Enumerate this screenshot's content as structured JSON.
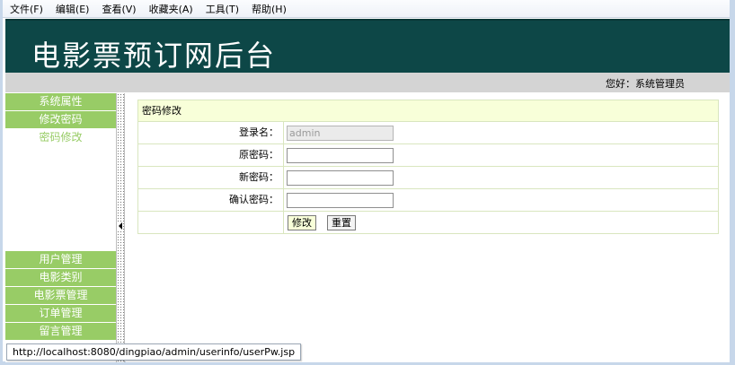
{
  "menubar": {
    "items": [
      "文件(F)",
      "编辑(E)",
      "查看(V)",
      "收藏夹(A)",
      "工具(T)",
      "帮助(H)"
    ]
  },
  "banner": {
    "title": "电影票预订网后台"
  },
  "userbar": {
    "greeting": "您好：系统管理员"
  },
  "sidebar": {
    "top_items": [
      "系统属性",
      "修改密码"
    ],
    "sub_items": [
      "密码修改"
    ],
    "bottom_items": [
      "用户管理",
      "电影类别",
      "电影票管理",
      "订单管理",
      "留言管理"
    ]
  },
  "form": {
    "title": "密码修改",
    "login_label": "登录名：",
    "login_value": "admin",
    "old_pwd_label": "原密码：",
    "new_pwd_label": "新密码：",
    "confirm_pwd_label": "确认密码：",
    "submit_label": "修改",
    "reset_label": "重置"
  },
  "status": {
    "url": "http://localhost:8080/dingpiao/admin/userinfo/userPw.jsp"
  },
  "colors": {
    "banner_bg": "#0d4747",
    "menu_green": "#98cc66",
    "form_title_bg": "#f8ffd9"
  },
  "icons": [
    "collapse-left-arrow-icon"
  ]
}
